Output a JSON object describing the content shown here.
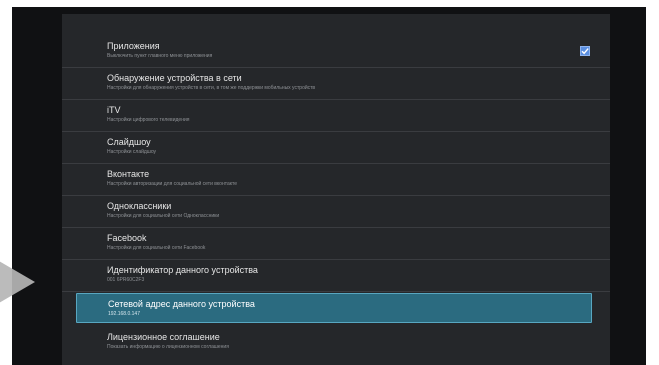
{
  "colors": {
    "background": "#101113",
    "panel": "#25272a",
    "selected": "#2b6b80",
    "selected_border": "#58a7c1",
    "checkbox": "#5b8fe0"
  },
  "settings": {
    "items": [
      {
        "title": "Приложения",
        "subtitle": "Выключить пункт главного меню приложения",
        "checked": true
      },
      {
        "title": "Обнаружение устройства в сети",
        "subtitle": "Настройки для обнаружения устройств в сети, в том же поддержки мобильных устройств"
      },
      {
        "title": "iTV",
        "subtitle": "Настройки цифрового телевидения"
      },
      {
        "title": "Слайдшоу",
        "subtitle": "Настройки слайдшоу"
      },
      {
        "title": "Вконтакте",
        "subtitle": "Настройки авторизации для социальной сети вконтакте"
      },
      {
        "title": "Одноклассники",
        "subtitle": "Настройки для социальной сети Одноклассники"
      },
      {
        "title": "Facebook",
        "subtitle": "Настройки для социальной сети Facebook"
      },
      {
        "title": "Идентификатор данного устройства",
        "subtitle": "001 6PR60C2F3"
      },
      {
        "title": "Сетевой адрес данного устройства",
        "subtitle": "192.168.0.147",
        "selected": true
      },
      {
        "title": "Лицензионное соглашение",
        "subtitle": "Показать информацию о лицензионном соглашения"
      }
    ]
  }
}
